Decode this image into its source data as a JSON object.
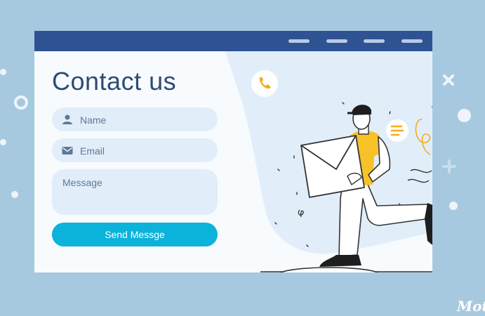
{
  "form": {
    "title": "Contact us",
    "name_placeholder": "Name",
    "email_placeholder": "Email",
    "message_placeholder": "Message",
    "send_label": "Send Messge"
  },
  "nav": {
    "items": 4
  },
  "watermark": {
    "text": "Mot"
  },
  "icons": [
    "user-icon",
    "mail-icon",
    "phone-icon",
    "chat-bubble-icon",
    "envelope-icon",
    "skateboard-icon"
  ],
  "colors": {
    "background": "#a7c9df",
    "titlebar": "#2f5392",
    "heading": "#2f4b73",
    "field": "#e1eef9",
    "button": "#0bb2d9",
    "accent_yellow": "#f7c227"
  }
}
